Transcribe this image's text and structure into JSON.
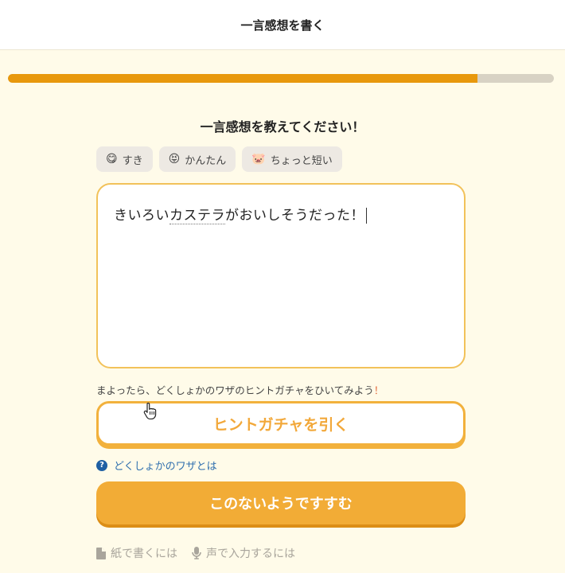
{
  "header": {
    "title": "一言感想を書く"
  },
  "progress": {
    "fraction": 0.86
  },
  "prompt": {
    "question": "一言感想を教えてください！"
  },
  "chips": [
    {
      "emoji": "😋",
      "label": "すき"
    },
    {
      "emoji": "😝",
      "label": "かんたん"
    },
    {
      "emoji": "🐷",
      "label": "ちょっと短い"
    }
  ],
  "editor": {
    "text_before": "きいろい",
    "text_underlined": "カステラ",
    "text_after": "がおいしそうだった！"
  },
  "hint": {
    "text": "まよったら、どくしょかのワザのヒントガチャをひいてみよう",
    "excl": "！",
    "button_label": "ヒントガチャを引く"
  },
  "help": {
    "label": "どくしょかのワザとは",
    "icon": "?"
  },
  "next": {
    "label": "このないようですすむ"
  },
  "footer": {
    "paper_label": "紙で書くには",
    "voice_label": "声で入力するには"
  },
  "colors": {
    "accent": "#f2ac36",
    "progress": "#e8980c",
    "background": "#fffbe9"
  }
}
